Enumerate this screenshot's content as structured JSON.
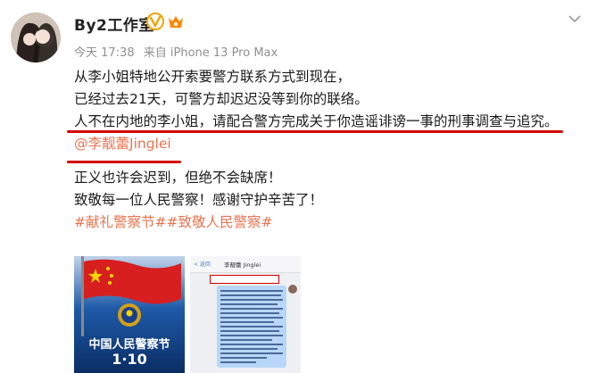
{
  "account": {
    "name": "By2工作室",
    "time": "今天 17:38",
    "source": "来自 iPhone 13 Pro Max"
  },
  "post": {
    "lines": [
      "从李小姐特地公开索要警方联系方式到现在，",
      "已经过去21天，可警方却迟迟没等到你的联络。",
      "人不在内地的李小姐，请配合警方完成关于你造谣诽谤一事的刑事调查与追究。"
    ],
    "mention": "@李靓蕾Jinglei",
    "closing": [
      "正义也许会迟到，但绝不会缺席！",
      "致敬每一位人民警察！感谢守护辛苦了！"
    ],
    "topics": "#献礼警察节##致敬人民警察#"
  },
  "images": {
    "poster_title": "中国人民警察节",
    "poster_date": "1·10",
    "chat_title": "李靓蕾 Jinglei",
    "chat_back": "< 返回"
  },
  "colors": {
    "link": "#eb7350",
    "underline": "#d40000"
  }
}
